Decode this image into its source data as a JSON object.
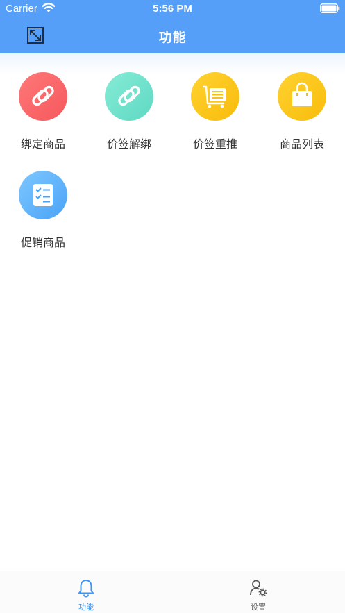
{
  "status_bar": {
    "carrier": "Carrier",
    "time": "5:56 PM"
  },
  "nav": {
    "title": "功能",
    "left_icon": "expand-icon"
  },
  "functions": [
    {
      "label": "绑定商品",
      "icon": "link-icon",
      "color": "#f5585d"
    },
    {
      "label": "价签解绑",
      "icon": "link-icon",
      "color": "#5ed8c3"
    },
    {
      "label": "价签重推",
      "icon": "cart-list-icon",
      "color": "#f8bc0b"
    },
    {
      "label": "商品列表",
      "icon": "shopping-bag-icon",
      "color": "#f8bc0b"
    },
    {
      "label": "促销商品",
      "icon": "checklist-icon",
      "color": "#4aa3f7"
    }
  ],
  "tabbar": {
    "tabs": [
      {
        "label": "功能",
        "icon": "bell-icon",
        "active": true
      },
      {
        "label": "设置",
        "icon": "user-settings-icon",
        "active": false
      }
    ],
    "active_color": "#3d95f5"
  },
  "colors": {
    "header": "#559ff9"
  }
}
